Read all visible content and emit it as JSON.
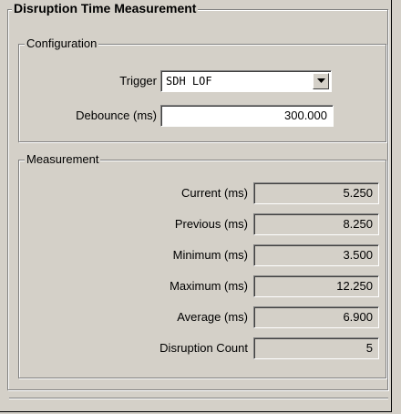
{
  "panel": {
    "title": "Disruption Time Measurement"
  },
  "configuration": {
    "legend": "Configuration",
    "trigger_label": "Trigger",
    "trigger_value": "SDH LOF",
    "debounce_label": "Debounce (ms)",
    "debounce_value": "300.000"
  },
  "measurement": {
    "legend": "Measurement",
    "rows": [
      {
        "label": "Current (ms)",
        "value": "5.250"
      },
      {
        "label": "Previous (ms)",
        "value": "8.250"
      },
      {
        "label": "Minimum (ms)",
        "value": "3.500"
      },
      {
        "label": "Maximum (ms)",
        "value": "12.250"
      },
      {
        "label": "Average (ms)",
        "value": "6.900"
      },
      {
        "label": "Disruption Count",
        "value": "5"
      }
    ]
  },
  "icons": {
    "dropdown": "chevron-down-icon"
  },
  "colors": {
    "window_bg": "#d4d0c8",
    "input_bg": "#ffffff",
    "readonly_bg": "#d4d0c8"
  }
}
